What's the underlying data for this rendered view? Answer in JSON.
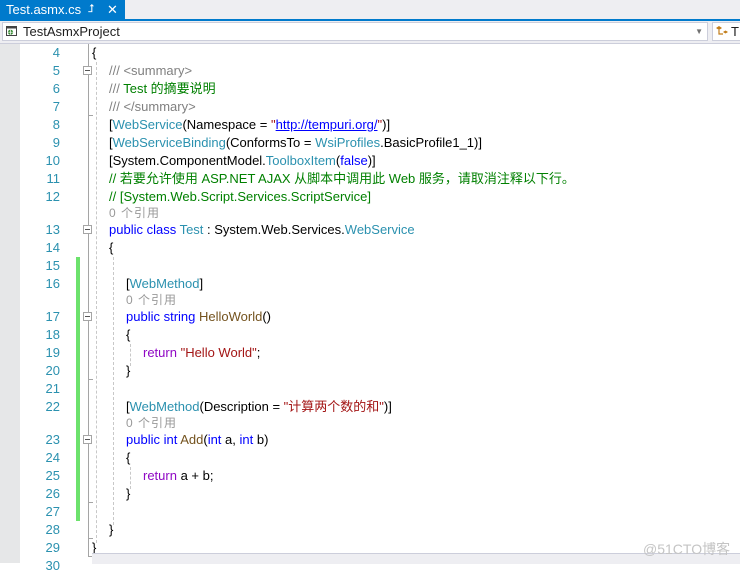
{
  "tab": {
    "title": "Test.asmx.cs",
    "pin_icon": "pin-icon",
    "close_icon": "close-icon"
  },
  "navbar": {
    "project_dropdown": {
      "icon": "csharp-project-icon",
      "label": "TestAsmxProject",
      "arrow": "▾"
    },
    "type_dropdown": {
      "icon": "class-icon",
      "label": "T"
    }
  },
  "colors": {
    "accent": "#007ACC",
    "keyword": "#0000FF",
    "type": "#2B91AF",
    "string": "#A31515",
    "comment": "#008000",
    "doc": "#808080",
    "method": "#74531F",
    "control": "#8F08C4",
    "line_number": "#2B91AF",
    "change_bar": "#6CE26C"
  },
  "editor": {
    "lines": [
      {
        "num": "4",
        "indent": 0,
        "tokens": [
          {
            "t": "{",
            "c": "plain"
          }
        ]
      },
      {
        "num": "5",
        "indent": 1,
        "fold": true,
        "tokens": [
          {
            "t": "/// <summary>",
            "c": "doc"
          }
        ]
      },
      {
        "num": "6",
        "indent": 1,
        "tokens": [
          {
            "t": "///",
            "c": "doc"
          },
          {
            "t": " Test 的摘要说明",
            "c": "cmt"
          }
        ]
      },
      {
        "num": "7",
        "indent": 1,
        "tokens": [
          {
            "t": "/// </summary>",
            "c": "doc"
          }
        ]
      },
      {
        "num": "8",
        "indent": 1,
        "tokens": [
          {
            "t": "[",
            "c": "plain"
          },
          {
            "t": "WebService",
            "c": "type"
          },
          {
            "t": "(Namespace = ",
            "c": "plain"
          },
          {
            "t": "\"",
            "c": "str"
          },
          {
            "t": "http://tempuri.org/",
            "c": "link"
          },
          {
            "t": "\"",
            "c": "str"
          },
          {
            "t": ")]",
            "c": "plain"
          }
        ]
      },
      {
        "num": "9",
        "indent": 1,
        "tokens": [
          {
            "t": "[",
            "c": "plain"
          },
          {
            "t": "WebServiceBinding",
            "c": "type"
          },
          {
            "t": "(ConformsTo = ",
            "c": "plain"
          },
          {
            "t": "WsiProfiles",
            "c": "type"
          },
          {
            "t": ".BasicProfile1_1)]",
            "c": "plain"
          }
        ]
      },
      {
        "num": "10",
        "indent": 1,
        "tokens": [
          {
            "t": "[System.ComponentModel.",
            "c": "plain"
          },
          {
            "t": "ToolboxItem",
            "c": "type"
          },
          {
            "t": "(",
            "c": "plain"
          },
          {
            "t": "false",
            "c": "kw"
          },
          {
            "t": ")]",
            "c": "plain"
          }
        ]
      },
      {
        "num": "11",
        "indent": 1,
        "tokens": [
          {
            "t": "// 若要允许使用 ASP.NET AJAX 从脚本中调用此 Web 服务，请取消注释以下行。",
            "c": "cmt"
          }
        ]
      },
      {
        "num": "12",
        "indent": 1,
        "tokens": [
          {
            "t": "// [System.Web.Script.Services.ScriptService]",
            "c": "cmt"
          }
        ]
      },
      {
        "lens": "0 个引用",
        "indent": 1
      },
      {
        "num": "13",
        "indent": 1,
        "fold": true,
        "tokens": [
          {
            "t": "public class ",
            "c": "kw"
          },
          {
            "t": "Test",
            "c": "type"
          },
          {
            "t": " : System.Web.Services.",
            "c": "plain"
          },
          {
            "t": "WebService",
            "c": "type"
          }
        ]
      },
      {
        "num": "14",
        "indent": 1,
        "tokens": [
          {
            "t": "{",
            "c": "plain"
          }
        ]
      },
      {
        "num": "15",
        "indent": 2,
        "changed": true,
        "tokens": []
      },
      {
        "num": "16",
        "indent": 2,
        "changed": true,
        "tokens": [
          {
            "t": "[",
            "c": "plain"
          },
          {
            "t": "WebMethod",
            "c": "type"
          },
          {
            "t": "]",
            "c": "plain"
          }
        ]
      },
      {
        "lens": "0 个引用",
        "indent": 2,
        "changed": true
      },
      {
        "num": "17",
        "indent": 2,
        "changed": true,
        "fold": true,
        "tokens": [
          {
            "t": "public string ",
            "c": "kw"
          },
          {
            "t": "HelloWorld",
            "c": "method"
          },
          {
            "t": "()",
            "c": "plain"
          }
        ]
      },
      {
        "num": "18",
        "indent": 2,
        "changed": true,
        "tokens": [
          {
            "t": "{",
            "c": "plain"
          }
        ]
      },
      {
        "num": "19",
        "indent": 3,
        "changed": true,
        "tokens": [
          {
            "t": "return ",
            "c": "ctrl"
          },
          {
            "t": "\"Hello World\"",
            "c": "str"
          },
          {
            "t": ";",
            "c": "plain"
          }
        ]
      },
      {
        "num": "20",
        "indent": 2,
        "changed": true,
        "tokens": [
          {
            "t": "}",
            "c": "plain"
          }
        ]
      },
      {
        "num": "21",
        "indent": 2,
        "changed": true,
        "tokens": []
      },
      {
        "num": "22",
        "indent": 2,
        "changed": true,
        "tokens": [
          {
            "t": "[",
            "c": "plain"
          },
          {
            "t": "WebMethod",
            "c": "type"
          },
          {
            "t": "(Description = ",
            "c": "plain"
          },
          {
            "t": "\"计算两个数的和\"",
            "c": "str"
          },
          {
            "t": ")]",
            "c": "plain"
          }
        ]
      },
      {
        "lens": "0 个引用",
        "indent": 2,
        "changed": true
      },
      {
        "num": "23",
        "indent": 2,
        "changed": true,
        "fold": true,
        "tokens": [
          {
            "t": "public int ",
            "c": "kw"
          },
          {
            "t": "Add",
            "c": "method"
          },
          {
            "t": "(",
            "c": "plain"
          },
          {
            "t": "int",
            "c": "kw"
          },
          {
            "t": " a, ",
            "c": "plain"
          },
          {
            "t": "int",
            "c": "kw"
          },
          {
            "t": " b)",
            "c": "plain"
          }
        ]
      },
      {
        "num": "24",
        "indent": 2,
        "changed": true,
        "tokens": [
          {
            "t": "{",
            "c": "plain"
          }
        ]
      },
      {
        "num": "25",
        "indent": 3,
        "changed": true,
        "tokens": [
          {
            "t": "return",
            "c": "ctrl"
          },
          {
            "t": " a + b;",
            "c": "plain"
          }
        ]
      },
      {
        "num": "26",
        "indent": 2,
        "changed": true,
        "tokens": [
          {
            "t": "}",
            "c": "plain"
          }
        ]
      },
      {
        "num": "27",
        "indent": 2,
        "changed": true,
        "tokens": []
      },
      {
        "num": "28",
        "indent": 1,
        "tokens": [
          {
            "t": "}",
            "c": "plain"
          }
        ]
      },
      {
        "num": "29",
        "indent": 0,
        "tokens": [
          {
            "t": "}",
            "c": "plain"
          }
        ]
      },
      {
        "num": "30",
        "indent": 0,
        "tokens": []
      }
    ]
  },
  "watermark": "@51CTO博客"
}
